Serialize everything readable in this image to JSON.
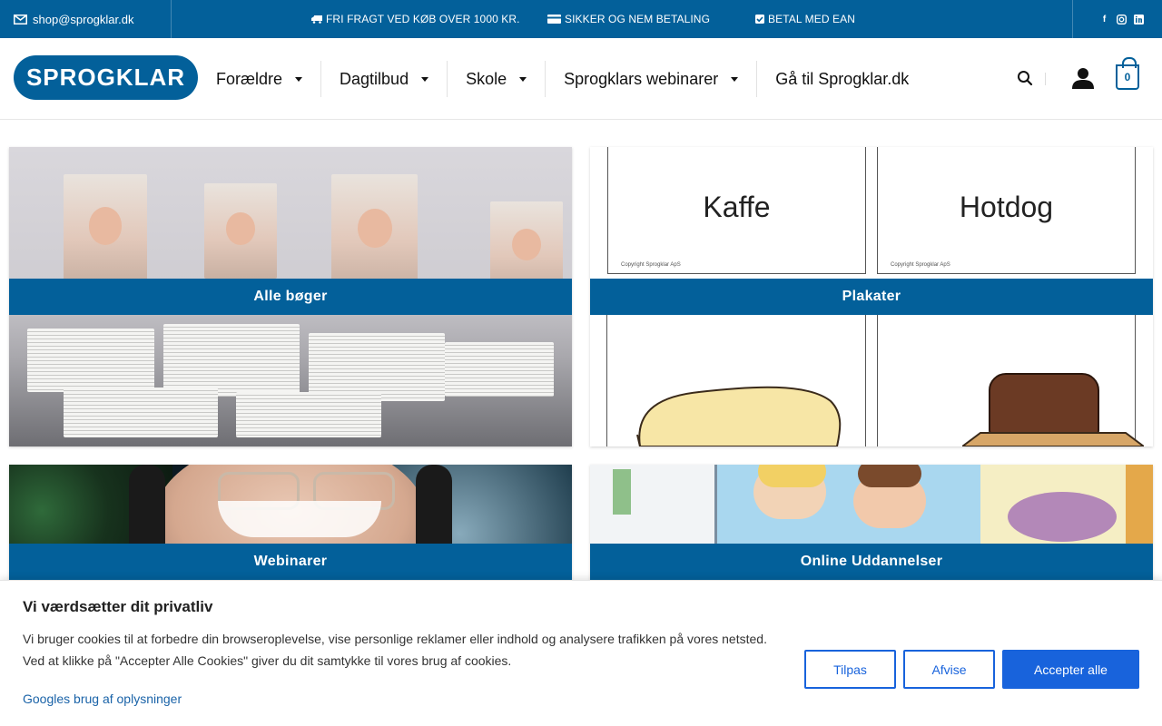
{
  "topbar": {
    "email": "shop@sprogklar.dk",
    "messages": [
      {
        "icon": "truck-icon",
        "text": "FRI FRAGT VED KØB OVER 1000 KR."
      },
      {
        "icon": "credit-card-icon",
        "text": "SIKKER OG NEM BETALING"
      },
      {
        "icon": "check-square-icon",
        "text": "BETAL MED EAN"
      }
    ],
    "social": [
      "facebook-icon",
      "instagram-icon",
      "linkedin-icon"
    ]
  },
  "header": {
    "logo_text": "SPROGKLAR",
    "nav": [
      {
        "label": "Forældre",
        "dropdown": true
      },
      {
        "label": "Dagtilbud",
        "dropdown": true
      },
      {
        "label": "Skole",
        "dropdown": true
      },
      {
        "label": "Sprogklars webinarer",
        "dropdown": true
      },
      {
        "label": "Gå til Sprogklar.dk",
        "dropdown": false
      }
    ],
    "cart_count": "0"
  },
  "tiles": [
    {
      "label": "Alle bøger"
    },
    {
      "label": "Plakater",
      "words": [
        "Kaffe",
        "Hotdog"
      ],
      "copyright": "Copyright Sprogklar ApS"
    },
    {
      "label": "Webinarer"
    },
    {
      "label": "Online Uddannelser"
    }
  ],
  "cookie": {
    "title": "Vi værdsætter dit privatliv",
    "text": "Vi bruger cookies til at forbedre din browseroplevelse, vise personlige reklamer eller indhold og analysere trafikken på vores netsted. Ved at klikke på \"Accepter Alle Cookies\" giver du dit samtykke til vores brug af cookies.",
    "link": "Googles brug af oplysninger",
    "buttons": {
      "customize": "Tilpas",
      "reject": "Afvise",
      "accept": "Accepter alle"
    }
  },
  "colors": {
    "brand": "#03609a",
    "cookie_accent": "#1863dc"
  }
}
